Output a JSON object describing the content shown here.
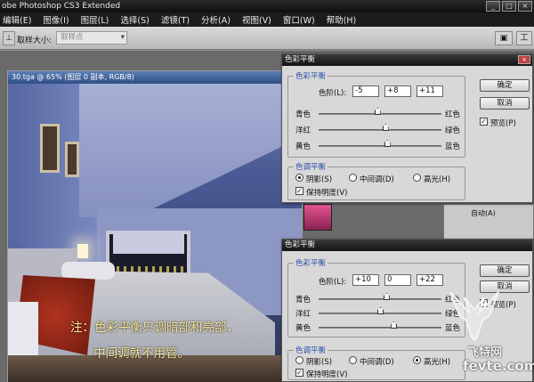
{
  "app": {
    "title": "obe Photoshop CS3 Extended",
    "window_buttons": [
      "_",
      "□",
      "×"
    ]
  },
  "menu": [
    "编辑(E)",
    "图像(I)",
    "图层(L)",
    "选择(S)",
    "滤镜(T)",
    "分析(A)",
    "视图(V)",
    "窗口(W)",
    "帮助(H)"
  ],
  "options_bar": {
    "sample_size_label": "取样大小:",
    "sample_size_value": "取样点",
    "tool_glyph": "⊥",
    "workspace_glyph": "▣",
    "workspace_menu": "工"
  },
  "document": {
    "tab_title": "30.tga @ 65% (图层 0 副本, RGB/8)"
  },
  "annotation": {
    "line1": "注：色彩平衡只调暗部和亮部，",
    "line2": "中间调就不用管。"
  },
  "dialog_top": {
    "title": "色彩平衡",
    "group_balance": "色彩平衡",
    "levels_label": "色阶(L):",
    "levels": [
      "-5",
      "+8",
      "+11"
    ],
    "sliders": [
      {
        "left": "青色",
        "right": "红色",
        "value": -5
      },
      {
        "left": "洋红",
        "right": "绿色",
        "value": 8
      },
      {
        "left": "黄色",
        "right": "蓝色",
        "value": 11
      }
    ],
    "ok": "确定",
    "cancel": "取消",
    "preview": "预览(P)",
    "group_tone": "色调平衡",
    "tones": [
      "阴影(S)",
      "中间调(D)",
      "高光(H)"
    ],
    "selected_tone": "阴影(S)",
    "preserve": "保持明度(V)"
  },
  "dialog_bottom": {
    "title": "色彩平衡",
    "group_balance": "色彩平衡",
    "levels_label": "色阶(L):",
    "levels": [
      "+10",
      "0",
      "+22"
    ],
    "sliders": [
      {
        "left": "青色",
        "right": "红色",
        "value": 10
      },
      {
        "left": "洋红",
        "right": "绿色",
        "value": 0
      },
      {
        "left": "黄色",
        "right": "蓝色",
        "value": 22
      }
    ],
    "ok": "确定",
    "cancel": "取消",
    "preview": "预览(P)",
    "group_tone": "色调平衡",
    "tones": [
      "阴影(S)",
      "中间调(D)",
      "高光(H)"
    ],
    "selected_tone": "高光(H)",
    "preserve": "保持明度(V)"
  },
  "panel_fragment": {
    "label": "自动(A)"
  },
  "watermark": {
    "name": "飞特网",
    "url": "fevte.com"
  },
  "colors": {
    "menubar": "#1c1c1c",
    "dialog_bg": "#d8d8d8",
    "group_title": "#2a50a8",
    "annotation": "#fbe79a"
  }
}
